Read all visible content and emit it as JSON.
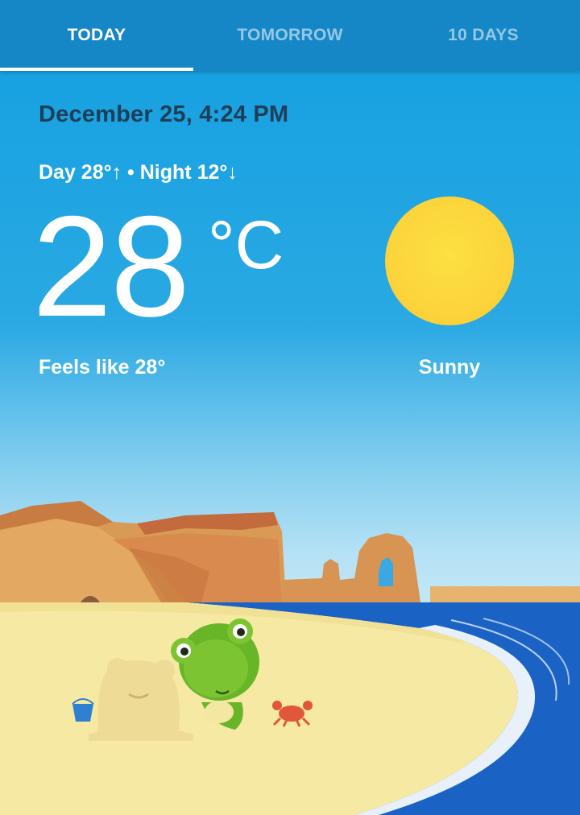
{
  "tabs": [
    {
      "label": "TODAY",
      "active": true
    },
    {
      "label": "TOMORROW",
      "active": false
    },
    {
      "label": "10 DAYS",
      "active": false
    }
  ],
  "weather": {
    "datetime": "December 25, 4:24 PM",
    "day_night": "Day 28°↑ • Night 12°↓",
    "temperature": "28",
    "unit": "°C",
    "feels_like": "Feels like 28°",
    "condition": "Sunny",
    "condition_icon": "sun-icon"
  },
  "colors": {
    "tab_bar": "#1586c6",
    "sky_top": "#17a1e1",
    "date_text": "#1f3e57",
    "sun": "#fcd43c",
    "sea": "#1a63c4",
    "sand": "#f6e9a4"
  }
}
